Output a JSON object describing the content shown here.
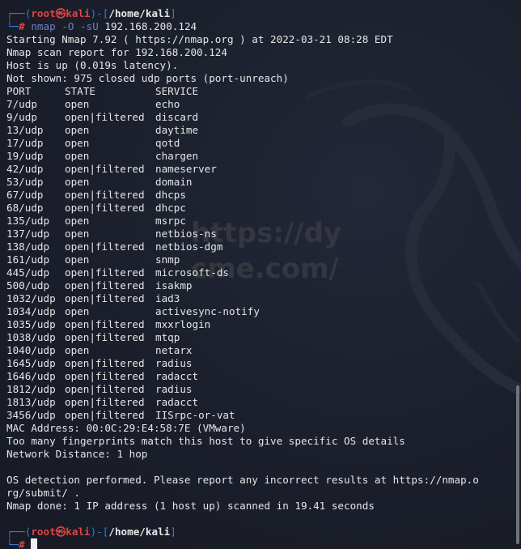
{
  "prompt1": {
    "user": "root",
    "skull": "㉿",
    "host": "kali",
    "path": "/home/kali",
    "command_name": "nmap",
    "flags": "-O -sU",
    "target": "192.168.200.124"
  },
  "output_header": [
    "Starting Nmap 7.92 ( https://nmap.org ) at 2022-03-21 08:28 EDT",
    "Nmap scan report for 192.168.200.124",
    "Host is up (0.019s latency).",
    "Not shown: 975 closed udp ports (port-unreach)"
  ],
  "table": {
    "columns": [
      "PORT",
      "STATE",
      "SERVICE"
    ],
    "rows": [
      {
        "port": "7/udp",
        "state": "open",
        "service": "echo"
      },
      {
        "port": "9/udp",
        "state": "open|filtered",
        "service": "discard"
      },
      {
        "port": "13/udp",
        "state": "open",
        "service": "daytime"
      },
      {
        "port": "17/udp",
        "state": "open",
        "service": "qotd"
      },
      {
        "port": "19/udp",
        "state": "open",
        "service": "chargen"
      },
      {
        "port": "42/udp",
        "state": "open|filtered",
        "service": "nameserver"
      },
      {
        "port": "53/udp",
        "state": "open",
        "service": "domain"
      },
      {
        "port": "67/udp",
        "state": "open|filtered",
        "service": "dhcps"
      },
      {
        "port": "68/udp",
        "state": "open|filtered",
        "service": "dhcpc"
      },
      {
        "port": "135/udp",
        "state": "open",
        "service": "msrpc"
      },
      {
        "port": "137/udp",
        "state": "open",
        "service": "netbios-ns"
      },
      {
        "port": "138/udp",
        "state": "open|filtered",
        "service": "netbios-dgm"
      },
      {
        "port": "161/udp",
        "state": "open",
        "service": "snmp"
      },
      {
        "port": "445/udp",
        "state": "open|filtered",
        "service": "microsoft-ds"
      },
      {
        "port": "500/udp",
        "state": "open|filtered",
        "service": "isakmp"
      },
      {
        "port": "1032/udp",
        "state": "open|filtered",
        "service": "iad3"
      },
      {
        "port": "1034/udp",
        "state": "open",
        "service": "activesync-notify"
      },
      {
        "port": "1035/udp",
        "state": "open|filtered",
        "service": "mxxrlogin"
      },
      {
        "port": "1038/udp",
        "state": "open|filtered",
        "service": "mtqp"
      },
      {
        "port": "1040/udp",
        "state": "open",
        "service": "netarx"
      },
      {
        "port": "1645/udp",
        "state": "open|filtered",
        "service": "radius"
      },
      {
        "port": "1646/udp",
        "state": "open|filtered",
        "service": "radacct"
      },
      {
        "port": "1812/udp",
        "state": "open|filtered",
        "service": "radius"
      },
      {
        "port": "1813/udp",
        "state": "open|filtered",
        "service": "radacct"
      },
      {
        "port": "3456/udp",
        "state": "open|filtered",
        "service": "IISrpc-or-vat"
      }
    ]
  },
  "output_footer": [
    "MAC Address: 00:0C:29:E4:58:7E (VMware)",
    "Too many fingerprints match this host to give specific OS details",
    "Network Distance: 1 hop",
    "",
    "OS detection performed. Please report any incorrect results at https://nmap.o",
    "rg/submit/ .",
    "Nmap done: 1 IP address (1 host up) scanned in 19.41 seconds",
    ""
  ],
  "prompt2": {
    "user": "root",
    "skull": "㉿",
    "host": "kali",
    "path": "/home/kali"
  },
  "watermark": {
    "line1": "https://dy",
    "line2": "cme.com/"
  },
  "colors": {
    "prompt_blue": "#2f7dd8",
    "prompt_red": "#e04343",
    "text": "#e6e6e6",
    "background": "#1b1f2b"
  }
}
